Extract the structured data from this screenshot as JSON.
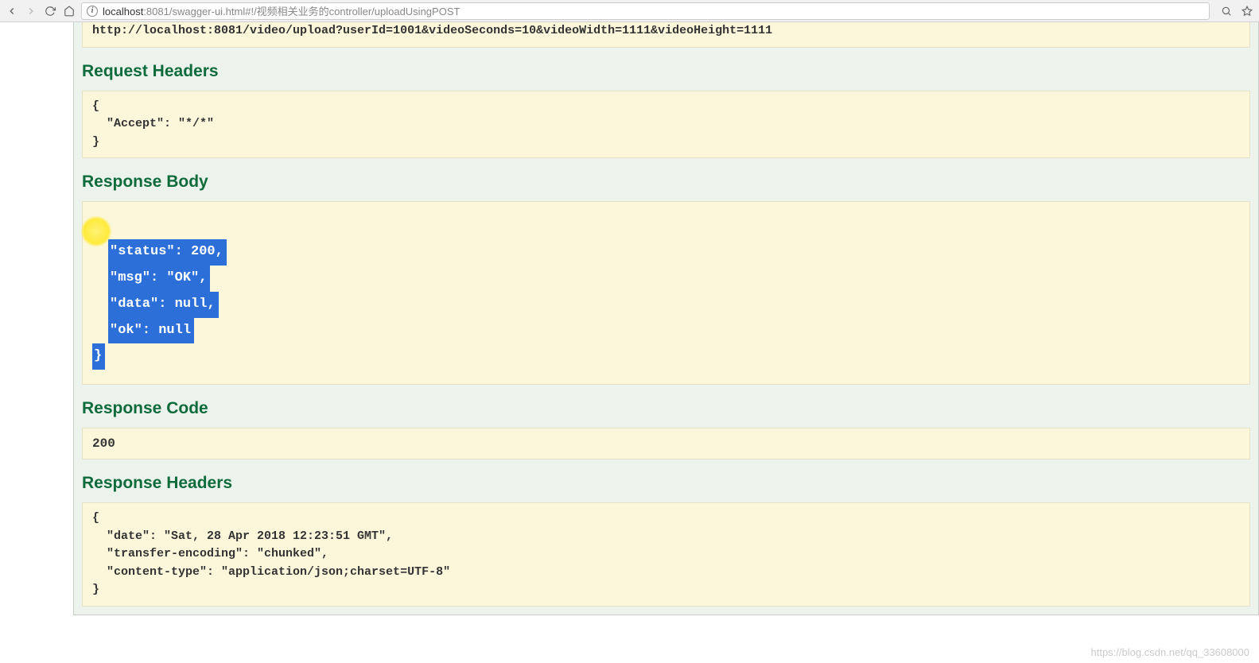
{
  "browser": {
    "url_host": "localhost",
    "url_port": ":8081",
    "url_path": "/swagger-ui.html#!/视频相关业务的controller/uploadUsingPOST"
  },
  "request_url": "http://localhost:8081/video/upload?userId=1001&videoSeconds=10&videoWidth=1111&videoHeight=1111",
  "sections": {
    "request_headers_title": "Request Headers",
    "response_body_title": "Response Body",
    "response_code_title": "Response Code",
    "response_headers_title": "Response Headers"
  },
  "request_headers": "{\n  \"Accept\": \"*/*\"\n}",
  "response_body": {
    "open": "{",
    "line1_key": "\"status\"",
    "line1_val": "200",
    "line1_comma": ",",
    "line2_key": "\"msg\"",
    "line2_val": "\"OK\"",
    "line2_comma": ",",
    "line3_key": "\"data\"",
    "line3_val": "null",
    "line3_comma": ",",
    "line4_key": "\"ok\"",
    "line4_val": "null",
    "close": "}"
  },
  "response_code": "200",
  "response_headers": "{\n  \"date\": \"Sat, 28 Apr 2018 12:23:51 GMT\",\n  \"transfer-encoding\": \"chunked\",\n  \"content-type\": \"application/json;charset=UTF-8\"\n}",
  "watermark": "https://blog.csdn.net/qq_33608000"
}
